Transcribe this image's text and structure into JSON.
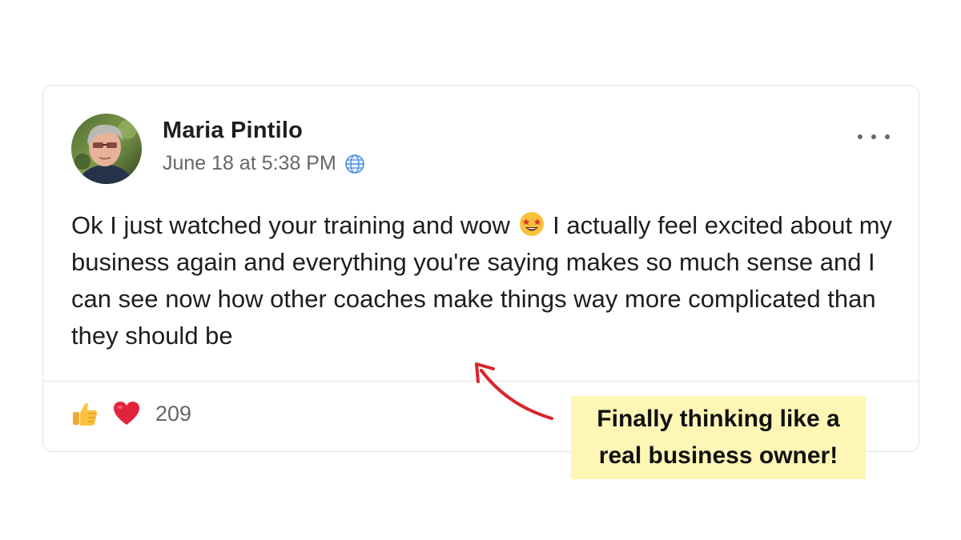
{
  "post": {
    "author_name": "Maria Pintilo",
    "timestamp": "June 18 at 5:38 PM",
    "audience_icon": "globe-icon",
    "more_icon": "more-options-icon",
    "text_before_emoji": "Ok I just watched your training and wow ",
    "emoji": "star-struck-emoji",
    "text_after_emoji": " I actually feel excited about my business again and everything you're saying makes so much sense and I can see now how other coaches make things way more complicated than they should be",
    "reactions": {
      "icons": [
        "thumbs-up-icon",
        "heart-icon"
      ],
      "count": "209"
    }
  },
  "callout": {
    "line1": "Finally thinking like a",
    "line2": "real business owner!",
    "background_color": "#fef6b5",
    "arrow_color": "#d9252a"
  }
}
